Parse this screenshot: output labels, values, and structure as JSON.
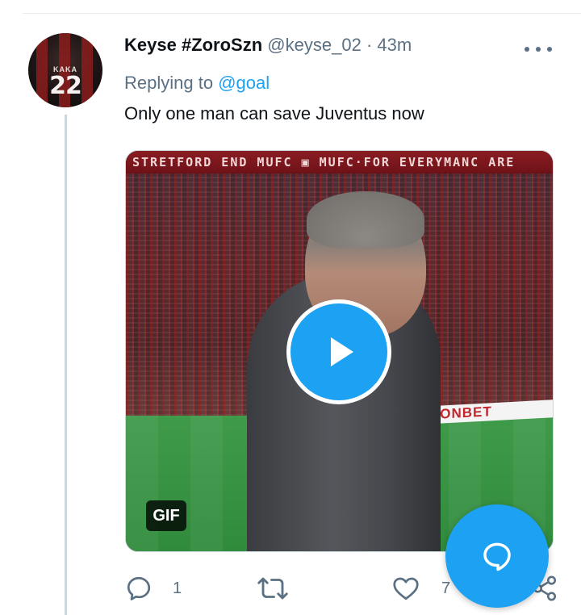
{
  "tweet": {
    "display_name": "Keyse #ZoroSzn",
    "handle": "@keyse_02",
    "separator": "·",
    "time": "43m",
    "replying_prefix": "Replying to",
    "replying_to": "@goal",
    "text": "Only one man can save Juventus now",
    "avatar": {
      "jersey_name": "KAKA",
      "jersey_number": "22"
    },
    "media": {
      "badge": "GIF",
      "banner_text": "STRETFORD END  MUFC  ▣ MUFC·FOR EVERYMANC ARE",
      "adboard_text": "HONBET",
      "type": "gif-video",
      "play_icon": "play-icon"
    },
    "actions": {
      "reply_count": "1",
      "retweet_count": "",
      "like_count": "7"
    }
  },
  "icons": {
    "more": "more-horizontal-icon",
    "reply": "reply-icon",
    "retweet": "retweet-icon",
    "like": "heart-icon",
    "share": "share-icon",
    "compose": "compose-reply-icon"
  },
  "colors": {
    "accent": "#1da1f2",
    "text_primary": "#0f1419",
    "text_secondary": "#5b7083",
    "thread_line": "#ccd6dd"
  }
}
